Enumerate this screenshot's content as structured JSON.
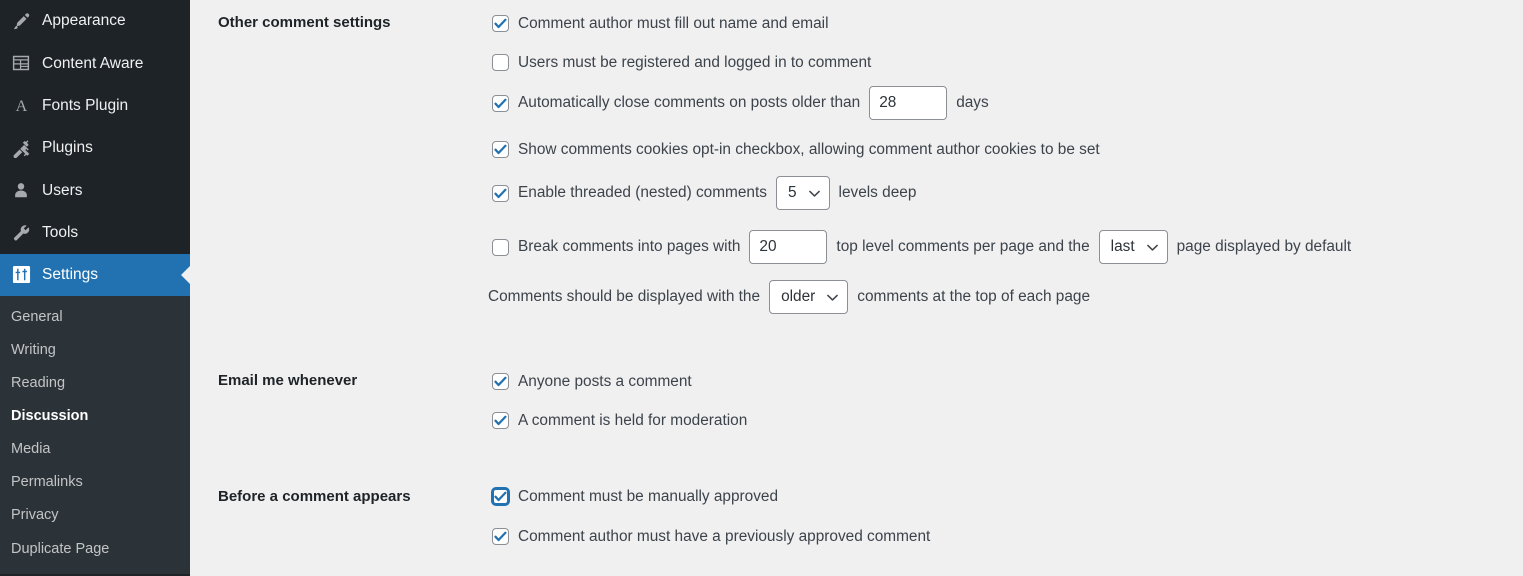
{
  "sidebar": {
    "items": [
      {
        "label": "Appearance",
        "icon": "paintbrush-icon",
        "current": false
      },
      {
        "label": "Content Aware",
        "icon": "layout-grid-icon",
        "current": false
      },
      {
        "label": "Fonts Plugin",
        "icon": "letter-a-icon",
        "current": false
      },
      {
        "label": "Plugins",
        "icon": "plug-icon",
        "current": false
      },
      {
        "label": "Users",
        "icon": "user-icon",
        "current": false
      },
      {
        "label": "Tools",
        "icon": "wrench-icon",
        "current": false
      },
      {
        "label": "Settings",
        "icon": "settings-sliders-icon",
        "current": true
      }
    ],
    "submenu": [
      {
        "label": "General",
        "current": false
      },
      {
        "label": "Writing",
        "current": false
      },
      {
        "label": "Reading",
        "current": false
      },
      {
        "label": "Discussion",
        "current": true
      },
      {
        "label": "Media",
        "current": false
      },
      {
        "label": "Permalinks",
        "current": false
      },
      {
        "label": "Privacy",
        "current": false
      },
      {
        "label": "Duplicate Page",
        "current": false
      }
    ]
  },
  "sections": {
    "other_comment_settings": {
      "label": "Other comment settings",
      "rows": {
        "author_name_email": "Comment author must fill out name and email",
        "must_be_registered": "Users must be registered and logged in to comment",
        "auto_close_prefix": "Automatically close comments on posts older than",
        "auto_close_days_value": "28",
        "auto_close_suffix": "days",
        "cookies_optin": "Show comments cookies opt-in checkbox, allowing comment author cookies to be set",
        "threaded_prefix": "Enable threaded (nested) comments",
        "threaded_levels_value": "5",
        "threaded_suffix": "levels deep",
        "break_pages_prefix": "Break comments into pages with",
        "break_pages_count_value": "20",
        "break_pages_mid": "top level comments per page and the",
        "break_pages_which_value": "last",
        "break_pages_suffix": "page displayed by default",
        "display_order_prefix": "Comments should be displayed with the",
        "display_order_value": "older",
        "display_order_suffix": "comments at the top of each page"
      }
    },
    "email_me_whenever": {
      "label": "Email me whenever",
      "rows": {
        "anyone_posts": "Anyone posts a comment",
        "held_for_moderation": "A comment is held for moderation"
      }
    },
    "before_comment_appears": {
      "label": "Before a comment appears",
      "rows": {
        "manually_approved": "Comment must be manually approved",
        "previously_approved": "Comment author must have a previously approved comment"
      }
    }
  },
  "colors": {
    "sidebar_bg": "#1d2327",
    "submenu_bg": "#2c3338",
    "accent": "#2271b1",
    "page_bg": "#f0f0f1",
    "text": "#3c434a"
  }
}
